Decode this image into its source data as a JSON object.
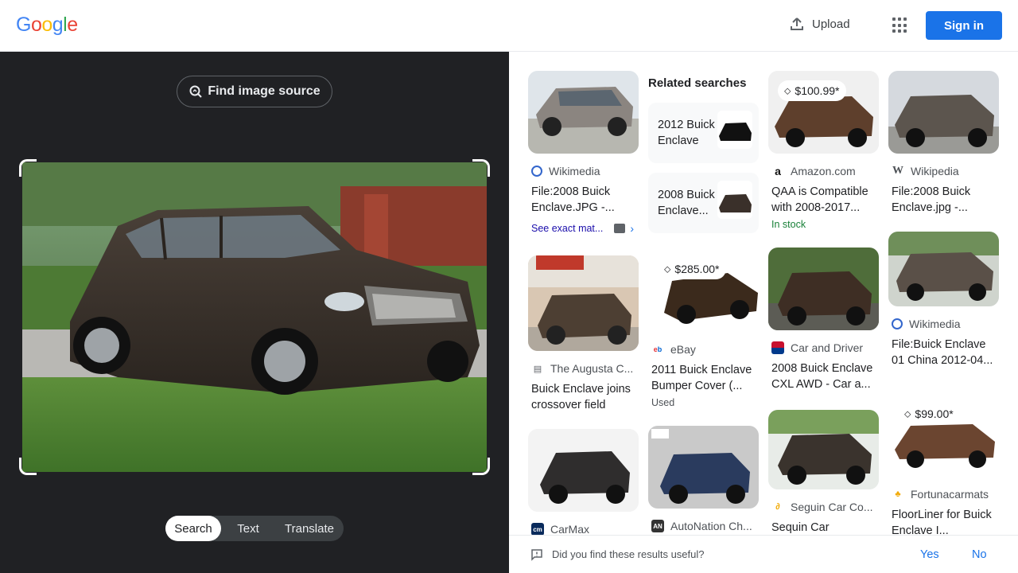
{
  "header": {
    "logo_letters": [
      {
        "ch": "G",
        "color": "#4285F4"
      },
      {
        "ch": "o",
        "color": "#EA4335"
      },
      {
        "ch": "o",
        "color": "#FBBC05"
      },
      {
        "ch": "g",
        "color": "#4285F4"
      },
      {
        "ch": "l",
        "color": "#34A853"
      },
      {
        "ch": "e",
        "color": "#EA4335"
      }
    ],
    "upload_label": "Upload",
    "signin_label": "Sign in"
  },
  "left": {
    "find_source_label": "Find image source",
    "modes": [
      "Search",
      "Text",
      "Translate"
    ],
    "active_mode": "Search"
  },
  "results": {
    "related_heading": "Related searches",
    "related": [
      {
        "label": "2012 Buick Enclave"
      },
      {
        "label": "2008 Buick Enclave..."
      }
    ],
    "cards": [
      {
        "source": "Wikimedia",
        "title": "File:2008 Buick Enclave.JPG -...",
        "see_exact": "See exact mat..."
      },
      {
        "source": "The Augusta C...",
        "title": "Buick Enclave joins crossover field"
      },
      {
        "source": "CarMax",
        "title": ""
      },
      {
        "source": "eBay",
        "price": "$285.00*",
        "title": "2011 Buick Enclave Bumper Cover (...",
        "meta": "Used"
      },
      {
        "source": "AutoNation Ch...",
        "title": ""
      },
      {
        "source": "Amazon.com",
        "price": "$100.99*",
        "title": "QAA is Compatible with 2008-2017...",
        "meta": "In stock"
      },
      {
        "source": "Car and Driver",
        "title": "2008 Buick Enclave CXL AWD - Car a..."
      },
      {
        "source": "Seguin Car Co...",
        "title": "Sequin Car"
      },
      {
        "source": "Wikipedia",
        "title": "File:2008 Buick Enclave.jpg -..."
      },
      {
        "source": "Wikimedia",
        "title": "File:Buick Enclave 01 China 2012-04..."
      },
      {
        "source": "Fortunacarmats",
        "price": "$99.00*",
        "title": "FloorLiner for Buick Enclave I..."
      }
    ]
  },
  "feedback": {
    "question": "Did you find these results useful?",
    "yes": "Yes",
    "no": "No"
  },
  "colors": {
    "accent": "#1a73e8",
    "dark_pane": "#202124"
  }
}
